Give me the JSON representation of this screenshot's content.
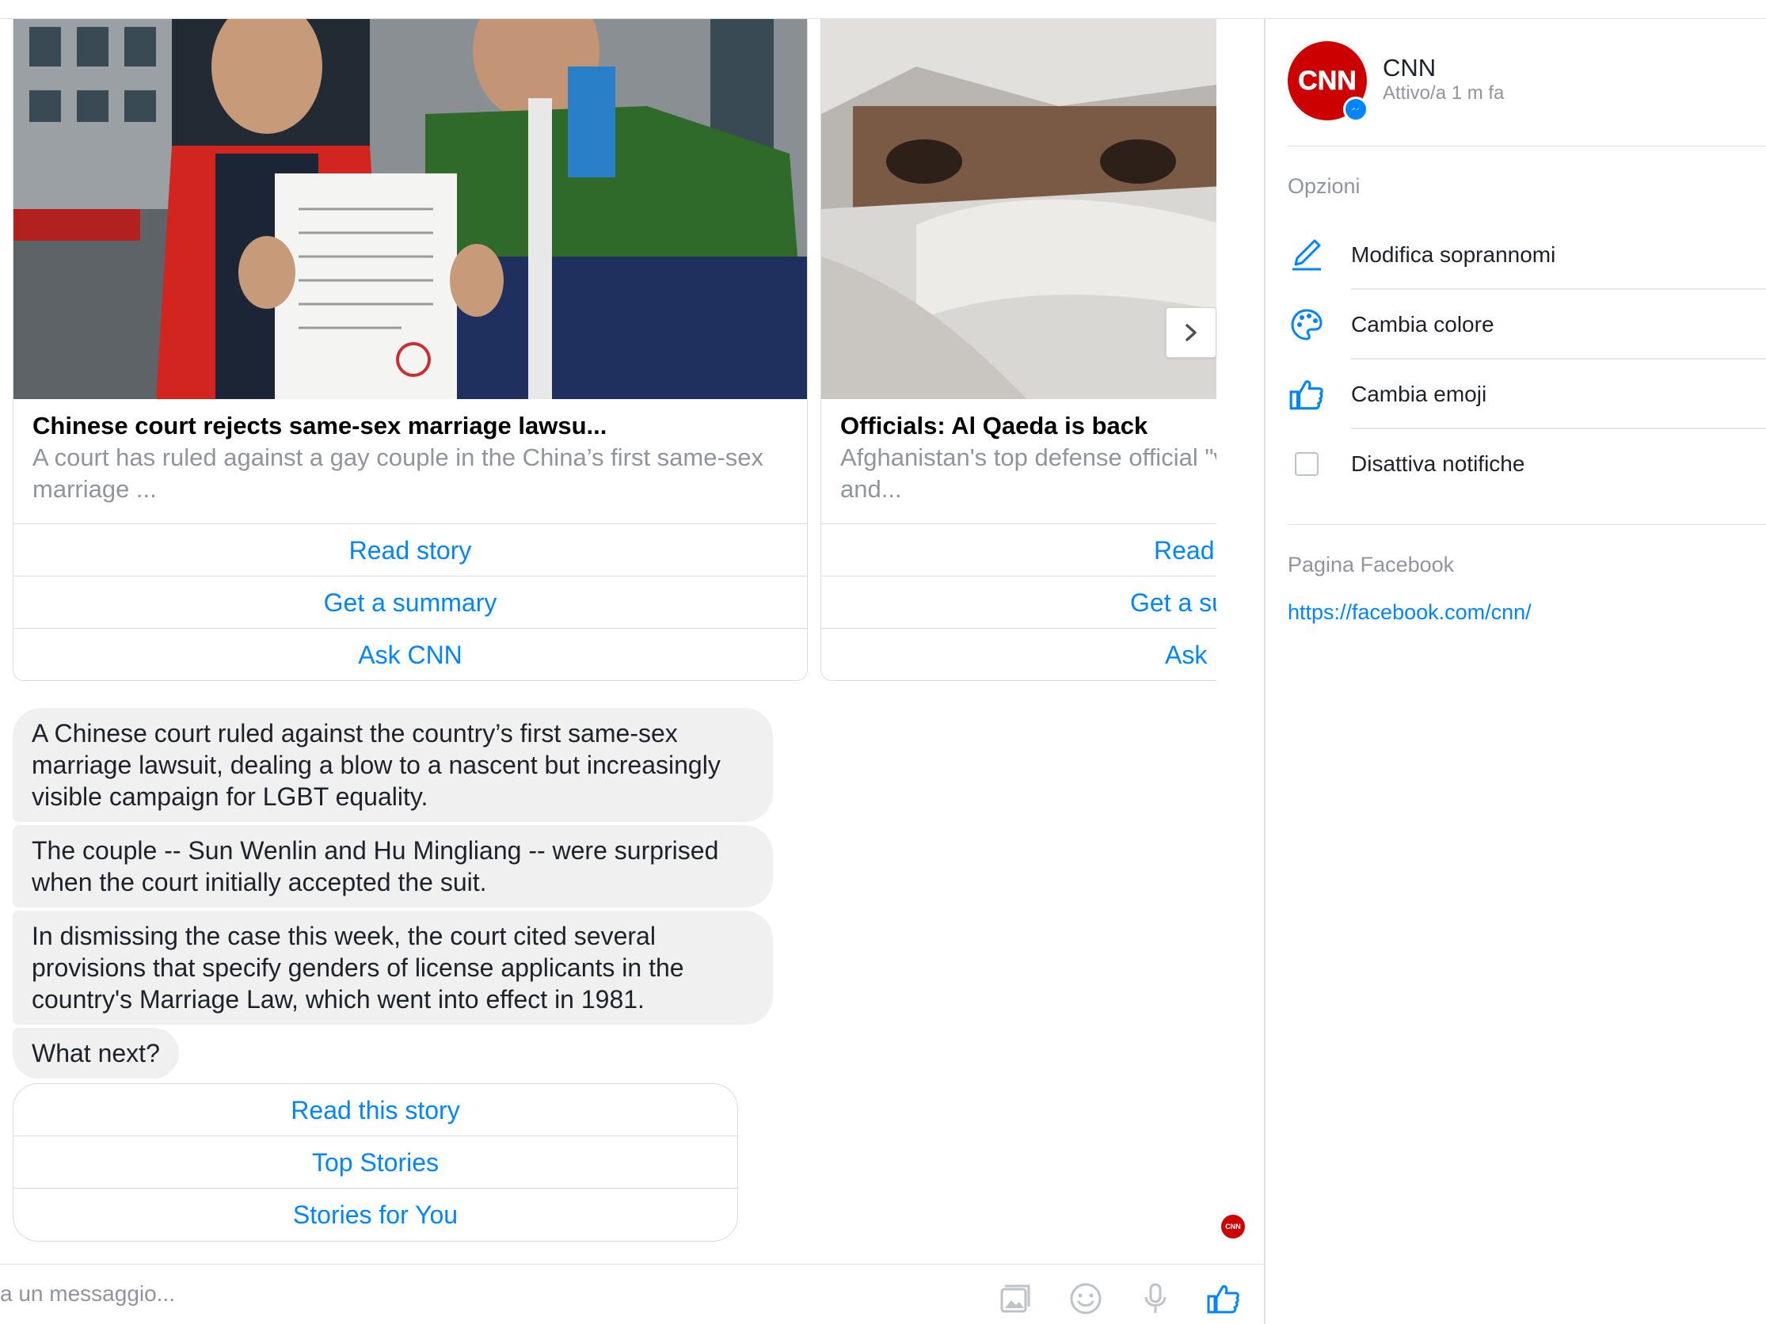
{
  "composer": {
    "placeholder": "a un messaggio..."
  },
  "carousel": {
    "cards": [
      {
        "title": "Chinese court rejects same-sex marriage lawsu...",
        "description": "A court has ruled against a gay couple in the China’s first same-sex marriage ...",
        "buttons": [
          "Read story",
          "Get a summary",
          "Ask CNN"
        ]
      },
      {
        "title": "Officials: Al Qaeda is back",
        "description": "Afghanistan's top defense official \"very active\" and...",
        "buttons": [
          "Read",
          "Get a su",
          "Ask"
        ]
      }
    ]
  },
  "messages": [
    "A Chinese court ruled against the country’s first same-sex marriage lawsuit, dealing a blow to a nascent but increasingly visible campaign for LGBT equality.",
    "The couple -- Sun Wenlin and Hu Mingliang -- were surprised when the court initially accepted the suit.",
    "In dismissing the case this week, the court cited several provisions that specify genders of license applicants in the country's Marriage Law, which went into effect in 1981.",
    "What next?"
  ],
  "quick_replies": [
    "Read this story",
    "Top Stories",
    "Stories for You"
  ],
  "panel": {
    "name": "CNN",
    "status": "Attivo/a 1 m fa",
    "options_label": "Opzioni",
    "options": [
      {
        "label": "Modifica soprannomi",
        "icon": "pencil-icon"
      },
      {
        "label": "Cambia colore",
        "icon": "palette-icon"
      },
      {
        "label": "Cambia emoji",
        "icon": "thumbs-up-icon"
      },
      {
        "label": "Disattiva notifiche",
        "icon": "checkbox"
      }
    ],
    "facebook_label": "Pagina Facebook",
    "facebook_url": "https://facebook.com/cnn/"
  },
  "logo_text": "CNN",
  "colors": {
    "accent": "#0084ff",
    "bubble": "#f1f0f0",
    "brand": "#cc0000",
    "muted": "#90949c"
  }
}
